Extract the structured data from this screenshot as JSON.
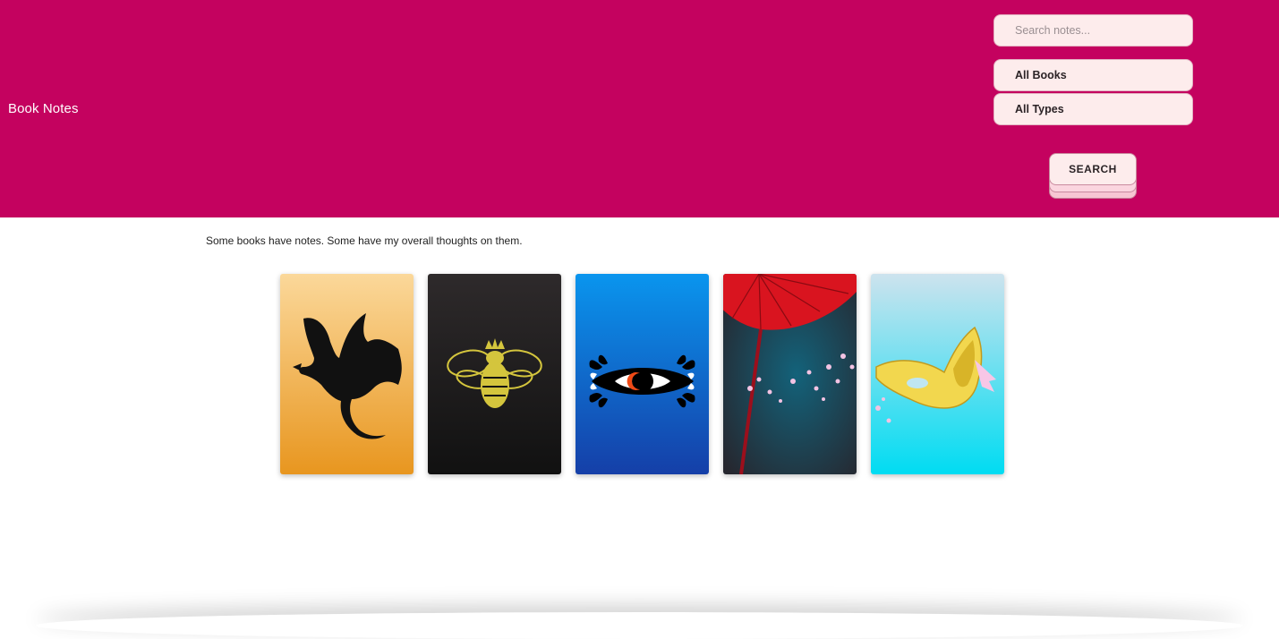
{
  "header": {
    "title": "Book Notes",
    "background": "#c4025f"
  },
  "filters": {
    "search_placeholder": "Search notes...",
    "book_select_value": "All Books",
    "type_select_value": "All Types",
    "search_button_label": "SEARCH"
  },
  "main": {
    "intro": "Some books have notes. Some have my overall thoughts on them.",
    "books": [
      {
        "cover_icon": "dragon-icon",
        "colors": [
          "#fbd89a",
          "#e8961f"
        ]
      },
      {
        "cover_icon": "bee-icon",
        "colors": [
          "#2e2a2b",
          "#111111"
        ]
      },
      {
        "cover_icon": "eye-icon",
        "colors": [
          "#0a95ee",
          "#153fa8"
        ]
      },
      {
        "cover_icon": "umbrella-icon",
        "colors": [
          "#0f4b5c",
          "#2b2b33"
        ]
      },
      {
        "cover_icon": "mask-icon",
        "colors": [
          "#cde3ee",
          "#00dcf2"
        ]
      }
    ]
  }
}
